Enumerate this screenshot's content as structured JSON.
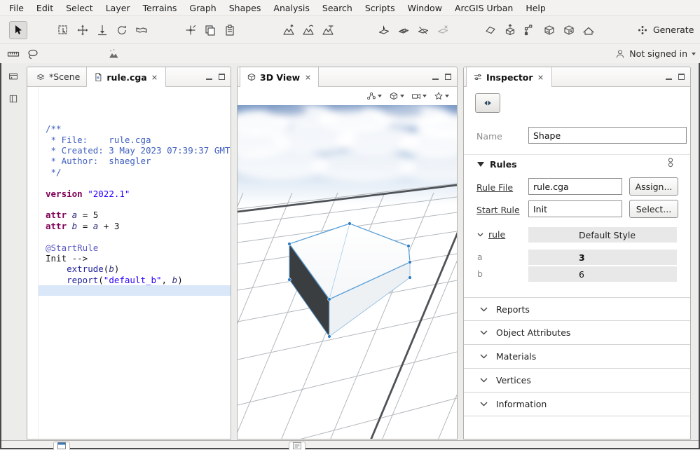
{
  "colors": {
    "keyword": "#7f0055",
    "string": "#2a00ff",
    "comment": "#3f5fbf",
    "annotation": "#5b5bc0",
    "attrname": "#33337f",
    "funcname": "#202099",
    "selline": "#d9e7f8",
    "accent": "#3875b0"
  },
  "menu": {
    "items": [
      "File",
      "Edit",
      "Select",
      "Layer",
      "Terrains",
      "Graph",
      "Shapes",
      "Analysis",
      "Search",
      "Scripts",
      "Window",
      "ArcGIS Urban",
      "Help"
    ]
  },
  "toolbar": {
    "generate_label": "Generate"
  },
  "signin": {
    "status": "Not signed in"
  },
  "left_panel": {
    "tabs": [
      {
        "label": "*Scene"
      },
      {
        "label": "rule.cga"
      }
    ],
    "code": {
      "lines": [
        {
          "segs": [
            {
              "t": "/**",
              "c": "com"
            }
          ]
        },
        {
          "segs": [
            {
              "t": " * File:    rule.cga",
              "c": "com"
            }
          ]
        },
        {
          "segs": [
            {
              "t": " * Created: 3 May 2023 07:39:37 GMT",
              "c": "com"
            }
          ]
        },
        {
          "segs": [
            {
              "t": " * Author:  shaegler",
              "c": "com"
            }
          ]
        },
        {
          "segs": [
            {
              "t": " */",
              "c": "com"
            }
          ]
        },
        {
          "segs": []
        },
        {
          "segs": [
            {
              "t": "version",
              "c": "kw"
            },
            {
              "t": " ",
              "c": "pl"
            },
            {
              "t": "\"2022.1\"",
              "c": "str"
            }
          ]
        },
        {
          "segs": []
        },
        {
          "segs": [
            {
              "t": "attr",
              "c": "kw"
            },
            {
              "t": " ",
              "c": "pl"
            },
            {
              "t": "a",
              "c": "attr"
            },
            {
              "t": " = 5",
              "c": "pl"
            }
          ]
        },
        {
          "segs": [
            {
              "t": "attr",
              "c": "kw"
            },
            {
              "t": " ",
              "c": "pl"
            },
            {
              "t": "b",
              "c": "attr"
            },
            {
              "t": " = ",
              "c": "pl"
            },
            {
              "t": "a",
              "c": "attr"
            },
            {
              "t": " + 3",
              "c": "pl"
            }
          ]
        },
        {
          "segs": []
        },
        {
          "segs": [
            {
              "t": "@StartRule",
              "c": "ann"
            }
          ]
        },
        {
          "segs": [
            {
              "t": "Init --> ",
              "c": "pl"
            }
          ]
        },
        {
          "segs": [
            {
              "t": "    ",
              "c": "pl"
            },
            {
              "t": "extrude",
              "c": "fn"
            },
            {
              "t": "(",
              "c": "pl"
            },
            {
              "t": "b",
              "c": "attr"
            },
            {
              "t": ")",
              "c": "pl"
            }
          ]
        },
        {
          "segs": [
            {
              "t": "    ",
              "c": "pl"
            },
            {
              "t": "report",
              "c": "fn"
            },
            {
              "t": "(",
              "c": "pl"
            },
            {
              "t": "\"default_b\"",
              "c": "str"
            },
            {
              "t": ", ",
              "c": "pl"
            },
            {
              "t": "b",
              "c": "attr"
            },
            {
              "t": ")",
              "c": "pl"
            }
          ]
        },
        {
          "hl": true,
          "segs": []
        }
      ]
    }
  },
  "view_panel": {
    "tab": "3D View"
  },
  "inspector": {
    "tab": "Inspector",
    "name_label": "Name",
    "name_value": "Shape",
    "rules_section": "Rules",
    "rule_file_label": "Rule File",
    "rule_file_value": "rule.cga",
    "assign_button": "Assign...",
    "start_rule_label": "Start Rule",
    "start_rule_value": "Init",
    "select_button": "Select...",
    "rule_link": "rule",
    "style_header": "Default Style",
    "attributes": [
      {
        "name": "a",
        "value": "3",
        "bold": true
      },
      {
        "name": "b",
        "value": "6",
        "bold": false
      }
    ],
    "sections": [
      "Reports",
      "Object Attributes",
      "Materials",
      "Vertices",
      "Information"
    ]
  }
}
